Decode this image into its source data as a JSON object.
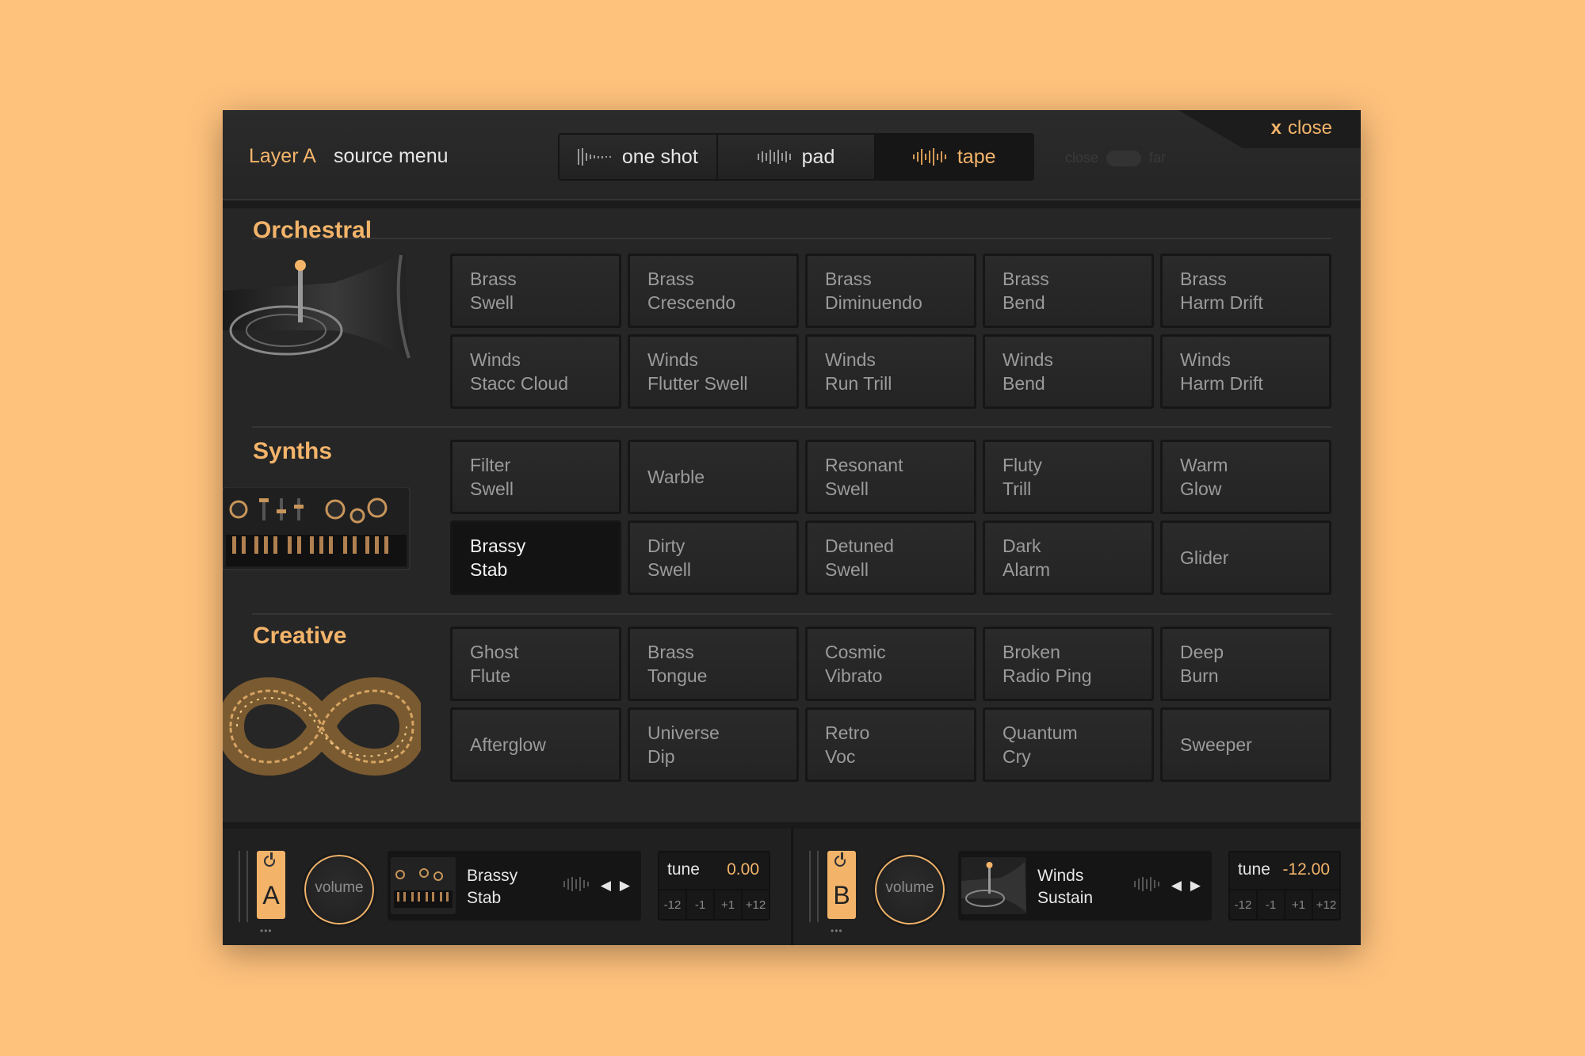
{
  "header": {
    "layer_label": "Layer A",
    "source_label": "source menu",
    "modes": [
      {
        "label": "one shot",
        "active": false
      },
      {
        "label": "pad",
        "active": false
      },
      {
        "label": "tape",
        "active": true
      }
    ],
    "close_label": "close",
    "close_glyph": "x",
    "dist_near": "close",
    "dist_far": "far"
  },
  "categories": [
    {
      "title": "Orchestral",
      "image_icon": "tuba-icon",
      "items": [
        "Brass\nSwell",
        "Brass\nCrescendo",
        "Brass\nDiminuendo",
        "Brass\nBend",
        "Brass\nHarm Drift",
        "Winds\nStacc Cloud",
        "Winds\nFlutter Swell",
        "Winds\nRun Trill",
        "Winds\nBend",
        "Winds\nHarm Drift"
      ]
    },
    {
      "title": "Synths",
      "image_icon": "synthesizer-icon",
      "items": [
        "Filter\nSwell",
        "Warble",
        "Resonant\nSwell",
        "Fluty\nTrill",
        "Warm\nGlow",
        "Brassy\nStab",
        "Dirty\nSwell",
        "Detuned\nSwell",
        "Dark\nAlarm",
        "Glider"
      ],
      "selected_index": 5
    },
    {
      "title": "Creative",
      "image_icon": "infinity-sculpture-icon",
      "items": [
        "Ghost\nFlute",
        "Brass\nTongue",
        "Cosmic\nVibrato",
        "Broken\nRadio Ping",
        "Deep\nBurn",
        "Afterglow",
        "Universe\nDip",
        "Retro\nVoc",
        "Quantum\nCry",
        "Sweeper"
      ]
    }
  ],
  "layers": [
    {
      "letter": "A",
      "volume_label": "volume",
      "source_name": "Brassy\nStab",
      "thumb_icon": "synthesizer-icon",
      "tune_label": "tune",
      "tune_value": "0.00",
      "steps": [
        "-12",
        "-1",
        "+1",
        "+12"
      ],
      "dots": "•••"
    },
    {
      "letter": "B",
      "volume_label": "volume",
      "source_name": "Winds\nSustain",
      "thumb_icon": "tuba-icon",
      "tune_label": "tune",
      "tune_value": "-12.00",
      "steps": [
        "-12",
        "-1",
        "+1",
        "+12"
      ],
      "dots": "•••"
    }
  ],
  "colors": {
    "accent": "#F3B46A",
    "background": "#FFC27D",
    "panel": "#262626"
  }
}
